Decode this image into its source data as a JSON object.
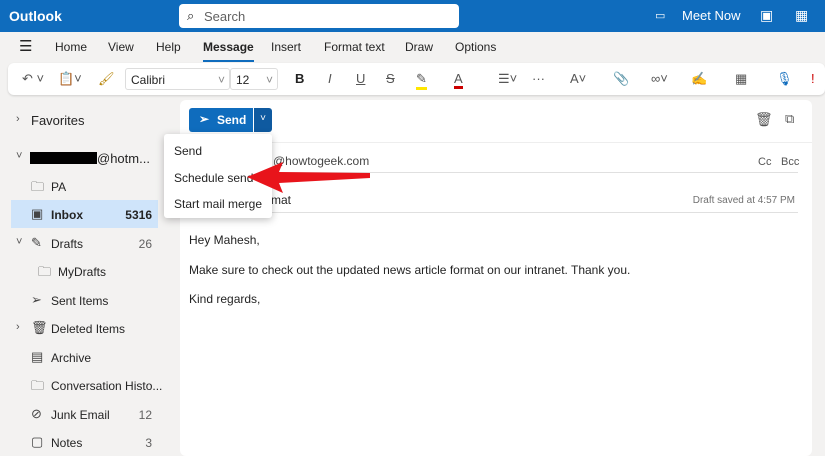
{
  "app": {
    "title": "Outlook",
    "search_placeholder": "Search",
    "meet_now": "Meet Now"
  },
  "tabs": [
    "Home",
    "View",
    "Help",
    "Message",
    "Insert",
    "Format text",
    "Draw",
    "Options"
  ],
  "toolbar": {
    "font": "Calibri",
    "size": "12"
  },
  "sidebar": {
    "favorites": "Favorites",
    "account": "@hotm...",
    "items": [
      {
        "label": "PA",
        "count": ""
      },
      {
        "label": "Inbox",
        "count": "5316"
      },
      {
        "label": "Drafts",
        "count": "26"
      },
      {
        "label": "MyDrafts",
        "count": ""
      },
      {
        "label": "Sent Items",
        "count": ""
      },
      {
        "label": "Deleted Items",
        "count": ""
      },
      {
        "label": "Archive",
        "count": ""
      },
      {
        "label": "Conversation Histo...",
        "count": ""
      },
      {
        "label": "Junk Email",
        "count": "12"
      },
      {
        "label": "Notes",
        "count": "3"
      }
    ]
  },
  "compose": {
    "send": "Send",
    "to": "@howtogeek.com",
    "cc": "Cc",
    "bcc": "Bcc",
    "subject_visible": "mat",
    "draft_saved": "Draft saved at 4:57 PM",
    "body": [
      "Hey Mahesh,",
      "Make sure to check out the updated news article format on our intranet. Thank you.",
      "Kind regards,"
    ]
  },
  "menu": {
    "items": [
      "Send",
      "Schedule send",
      "Start mail merge"
    ]
  },
  "colors": {
    "brand": "#0f6cbd",
    "arrow": "#e8141b"
  }
}
